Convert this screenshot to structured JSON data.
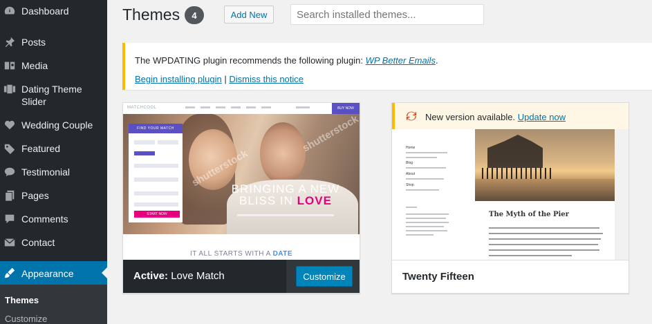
{
  "sidebar": {
    "items": [
      {
        "label": "Dashboard",
        "icon": "dashboard-icon"
      },
      {
        "label": "Posts",
        "icon": "pushpin-icon"
      },
      {
        "label": "Media",
        "icon": "media-icon"
      },
      {
        "label": "Dating Theme Slider",
        "icon": "slider-icon"
      },
      {
        "label": "Wedding Couple",
        "icon": "heart-icon"
      },
      {
        "label": "Featured",
        "icon": "tag-icon"
      },
      {
        "label": "Testimonial",
        "icon": "comment-icon"
      },
      {
        "label": "Pages",
        "icon": "pages-icon"
      },
      {
        "label": "Comments",
        "icon": "comments-icon"
      },
      {
        "label": "Contact",
        "icon": "envelope-icon"
      },
      {
        "label": "Appearance",
        "icon": "brush-icon"
      }
    ],
    "submenu": [
      {
        "label": "Themes"
      },
      {
        "label": "Customize"
      }
    ],
    "colors": {
      "background": "#23282d",
      "active": "#0073aa"
    }
  },
  "header": {
    "title": "Themes",
    "count": "4",
    "add_new_label": "Add New",
    "search_placeholder": "Search installed themes..."
  },
  "notice": {
    "text": "The WPDATING plugin recommends the following plugin: ",
    "plugin_link": "WP Better Emails",
    "period": ".",
    "install_link": "Begin installing plugin",
    "separator": " | ",
    "dismiss_link": "Dismiss this notice"
  },
  "themes": [
    {
      "active_prefix": "Active:",
      "name": "Love Match",
      "action_label": "Customize",
      "preview": {
        "nav_logo": "MATCHCOOL",
        "buy_label": "BUY NOW",
        "form_title": "FIND YOUR MATCH",
        "form_button": "START NOW",
        "headline_line1": "BRINGING A NEW",
        "headline_line2": "BLISS IN",
        "headline_accent": "LOVE",
        "tagline": "IT ALL STARTS WITH A",
        "tagline_accent": "DATE",
        "watermark": "shutterstock"
      }
    },
    {
      "name": "Twenty Fifteen",
      "update_text": "New version available.",
      "update_link": "Update now",
      "preview": {
        "post_title": "The Myth of the Pier",
        "sidebar_words": [
          "Home",
          "Blog",
          "About",
          "Shop"
        ]
      }
    }
  ]
}
